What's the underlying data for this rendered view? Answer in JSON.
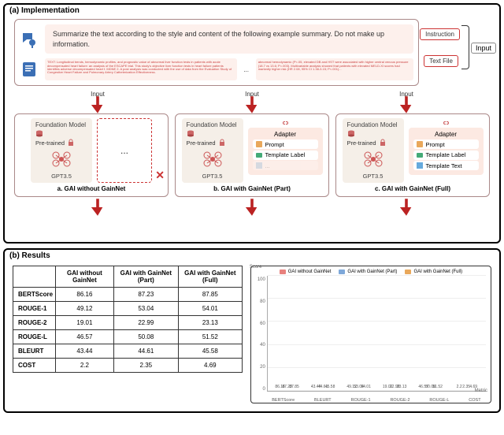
{
  "panel_a": {
    "title": "(a) Implementation",
    "instruction": "Summarize the text according to the style and content of the following example summary.\nDo not make up information.",
    "text_chunk_1": "TEXT: Longitudinal trends, hemodynamic profiles, and prognostic value of abnormal liver function tests in patients with acute decompensated heart failure: an analysis of the ESCAPE trial. This study's objective liver function tests in heart failure patients identifies adverse decompensated heart f. MDNE 2. A post analysis was conducted with the use of data from the Evaluation Study of Congestive Heart Failure and Pulmonary Artery Catheterization Effectiveness.",
    "text_chunk_2": "abnormal hemodynamic (P<.05, elevated DB and HST were associated with higher central venous pressure (18.7 vs 13.6; P=.003). Multivariable analysis showed that patients with elevated MELD-XI scores had markedly higher risk (HR 2.08, 95% CI 1.38-3.15; P<.001)...",
    "label_instruction": "Instruction",
    "label_textfile": "Text File",
    "label_input": "Input",
    "arrow_label": "Input",
    "models": {
      "fm_title": "Foundation Model",
      "pretrained": "Pre-trained",
      "gpt": "GPT3.5",
      "adapter_title": "Adapter",
      "prompt": "Prompt",
      "tmpl_label": "Template Label",
      "tmpl_text": "Template Text",
      "dots": "...",
      "cap_a": "a. GAI without GainNet",
      "cap_b": "b. GAI with GainNet (Part)",
      "cap_c": "c. GAI with GainNet (Full)"
    }
  },
  "panel_b": {
    "title": "(b) Results",
    "table": {
      "headers": [
        "",
        "GAI without GainNet",
        "GAI with GainNet (Part)",
        "GAI with GainNet (Full)"
      ],
      "rows": [
        [
          "BERTScore",
          "86.16",
          "87.23",
          "87.85"
        ],
        [
          "ROUGE-1",
          "49.12",
          "53.04",
          "54.01"
        ],
        [
          "ROUGE-2",
          "19.01",
          "22.99",
          "23.13"
        ],
        [
          "ROUGE-L",
          "46.57",
          "50.08",
          "51.52"
        ],
        [
          "BLEURT",
          "43.44",
          "44.61",
          "45.58"
        ],
        [
          "COST",
          "2.2",
          "2.35",
          "4.69"
        ]
      ]
    },
    "chart_legend": {
      "a": "GAI without GainNet",
      "b": "GAI with GainNet (Part)",
      "c": "GAI with GainNet (Full)"
    }
  },
  "chart_data": {
    "type": "bar",
    "title": "",
    "xlabel": "Metric",
    "ylabel": "Score",
    "ylim": [
      0,
      100
    ],
    "yticks": [
      0,
      20,
      40,
      60,
      80,
      100
    ],
    "categories": [
      "BERTScore",
      "BLEURT",
      "ROUGE-1",
      "ROUGE-2",
      "ROUGE-L",
      "COST"
    ],
    "series": [
      {
        "name": "GAI without GainNet",
        "color": "#e8817d",
        "values": [
          86.16,
          43.44,
          49.12,
          19.01,
          46.57,
          2.2
        ]
      },
      {
        "name": "GAI with GainNet (Part)",
        "color": "#7ea8d9",
        "values": [
          87.23,
          44.61,
          53.04,
          22.99,
          50.08,
          2.35
        ]
      },
      {
        "name": "GAI with GainNet (Full)",
        "color": "#e9a85b",
        "values": [
          87.85,
          45.58,
          54.01,
          23.13,
          51.52,
          4.69
        ]
      }
    ]
  }
}
